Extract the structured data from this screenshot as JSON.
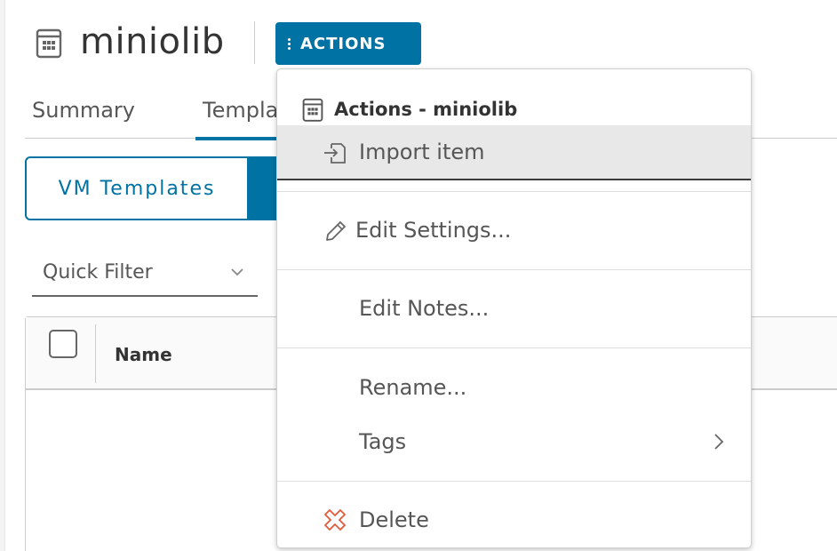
{
  "header": {
    "title": "miniolib",
    "actions_label": "ACTIONS"
  },
  "tabs": [
    {
      "label": "Summary"
    },
    {
      "label": "Templates"
    }
  ],
  "toggle": {
    "vm_templates_label": "VM Templates"
  },
  "filter": {
    "quick_filter_label": "Quick Filter"
  },
  "grid": {
    "columns": [
      "Name"
    ]
  },
  "menu": {
    "title": "Actions - miniolib",
    "items": [
      {
        "label": "Import item",
        "icon": "import-icon"
      },
      {
        "label": "Edit Settings...",
        "icon": "pencil-icon"
      },
      {
        "label": "Edit Notes..."
      },
      {
        "label": "Rename..."
      },
      {
        "label": "Tags",
        "icon": "chevron-right-icon"
      },
      {
        "label": "Delete",
        "icon": "delete-icon"
      }
    ]
  },
  "colors": {
    "accent": "#0072a3",
    "delete": "#e05a3a"
  }
}
